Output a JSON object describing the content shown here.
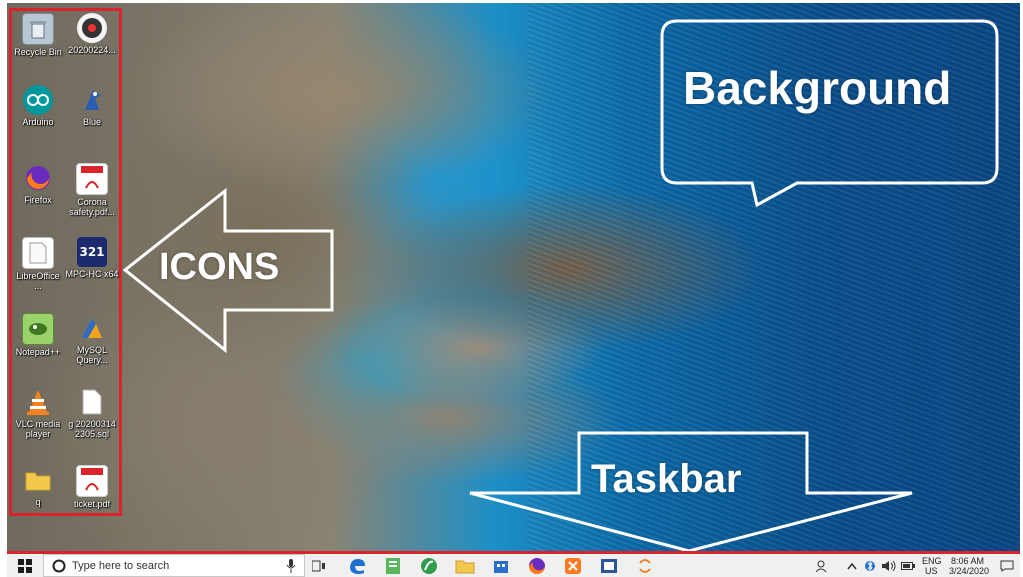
{
  "desktop": {
    "icons": [
      {
        "label": "Recycle Bin",
        "icon": "recycle-bin-icon"
      },
      {
        "label": "20200224...",
        "icon": "media-file-icon"
      },
      {
        "label": "Arduino",
        "icon": "arduino-icon"
      },
      {
        "label": "Blue",
        "icon": "bluej-icon"
      },
      {
        "label": "Firefox",
        "icon": "firefox-icon"
      },
      {
        "label": "Corona\nsafety.pdf...",
        "icon": "pdf-icon"
      },
      {
        "label": "LibreOffice\n...",
        "icon": "document-icon"
      },
      {
        "label": "MPC-HC x64",
        "icon": "mpc-hc-icon"
      },
      {
        "label": "Notepad++",
        "icon": "notepad-plus-plus-icon"
      },
      {
        "label": "MySQL\nQuery...",
        "icon": "mysql-icon"
      },
      {
        "label": "VLC media\nplayer",
        "icon": "vlc-icon"
      },
      {
        "label": "g 20200314\n2305.sql",
        "icon": "file-icon"
      },
      {
        "label": "q",
        "icon": "folder-icon"
      },
      {
        "label": "ticket.pdf",
        "icon": "pdf-icon"
      }
    ]
  },
  "annotations": {
    "icons_label": "ICONS",
    "background_label": "Background",
    "taskbar_label": "Taskbar"
  },
  "taskbar": {
    "search_placeholder": "Type here to search",
    "pinned_apps": [
      "task-view-icon",
      "edge-icon",
      "notepad-icon",
      "app-icon",
      "file-explorer-icon",
      "app-store-icon",
      "firefox-icon",
      "xampp-icon",
      "word-icon",
      "app-switch-icon"
    ],
    "tray": {
      "language": "ENG",
      "region": "US",
      "time": "8:06 AM",
      "date": "3/24/2020"
    }
  },
  "colors": {
    "highlight": "#d8242a",
    "taskbar_bg": "#f0f0f0"
  }
}
